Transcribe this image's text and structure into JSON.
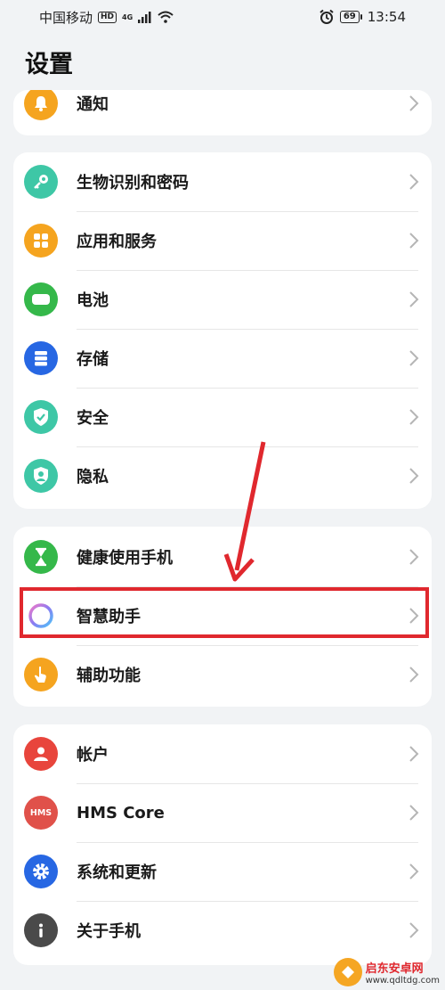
{
  "status_bar": {
    "carrier": "中国移动",
    "hd": "HD",
    "network": "4G",
    "battery": "69",
    "time": "13:54"
  },
  "page": {
    "title": "设置"
  },
  "groups": [
    {
      "items": [
        {
          "label": "通知",
          "icon": "bell-icon",
          "color": "#f5a41f"
        }
      ]
    },
    {
      "items": [
        {
          "label": "生物识别和密码",
          "icon": "key-icon",
          "color": "#3ec7a6"
        },
        {
          "label": "应用和服务",
          "icon": "apps-grid-icon",
          "color": "#f5a41f"
        },
        {
          "label": "电池",
          "icon": "battery-icon",
          "color": "#35b84a"
        },
        {
          "label": "存储",
          "icon": "storage-icon",
          "color": "#2767e3"
        },
        {
          "label": "安全",
          "icon": "shield-check-icon",
          "color": "#3ec7a6"
        },
        {
          "label": "隐私",
          "icon": "privacy-icon",
          "color": "#3ec7a6"
        }
      ]
    },
    {
      "items": [
        {
          "label": "健康使用手机",
          "icon": "hourglass-icon",
          "color": "#35b84a"
        },
        {
          "label": "智慧助手",
          "icon": "assistant-ring-icon",
          "color": "#8a7bf2"
        },
        {
          "label": "辅助功能",
          "icon": "hand-icon",
          "color": "#f5a41f"
        }
      ]
    },
    {
      "items": [
        {
          "label": "帐户",
          "icon": "account-icon",
          "color": "#e8453c"
        },
        {
          "label": "HMS Core",
          "icon": "hms-icon",
          "icon_text": "HMS",
          "color": "#e0514a"
        },
        {
          "label": "系统和更新",
          "icon": "gear-icon",
          "color": "#2767e3"
        },
        {
          "label": "关于手机",
          "icon": "info-icon",
          "color": "#4a4a4a"
        }
      ]
    }
  ],
  "watermark": {
    "title": "启东安卓网",
    "url": "www.qdltdg.com"
  },
  "colors": {
    "highlight": "#e0282e",
    "background": "#f1f3f5",
    "card": "#ffffff"
  }
}
